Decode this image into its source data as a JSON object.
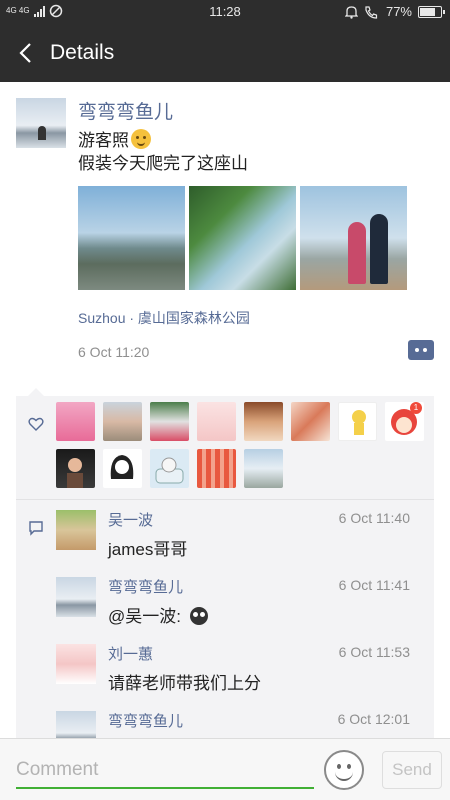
{
  "status_bar": {
    "network": "4G 4G",
    "time": "11:28",
    "battery": "77%",
    "battery_level": 0.77
  },
  "nav": {
    "title": "Details"
  },
  "post": {
    "author": "弯弯弯鱼儿",
    "text_line1": "游客照",
    "text_line2": "假装今天爬完了这座山",
    "location": "Suzhou · 虞山国家森林公园",
    "time": "6 Oct 11:20"
  },
  "likes": {
    "badge_count": "1"
  },
  "comments": [
    {
      "name": "吴一波",
      "time": "6 Oct 11:40",
      "text": "james哥哥"
    },
    {
      "name": "弯弯弯鱼儿",
      "time": "6 Oct 11:41",
      "text": "@吴一波: "
    },
    {
      "name": "刘一蕙",
      "time": "6 Oct 11:53",
      "text": "请薛老师带我们上分"
    },
    {
      "name": "弯弯弯鱼儿",
      "time": "6 Oct 12:01",
      "text": ""
    }
  ],
  "input": {
    "placeholder": "Comment",
    "send_label": "Send"
  },
  "colors": {
    "header_bg": "#2d2d2d",
    "link_blue": "#576b95",
    "accent_green": "#41b035"
  }
}
